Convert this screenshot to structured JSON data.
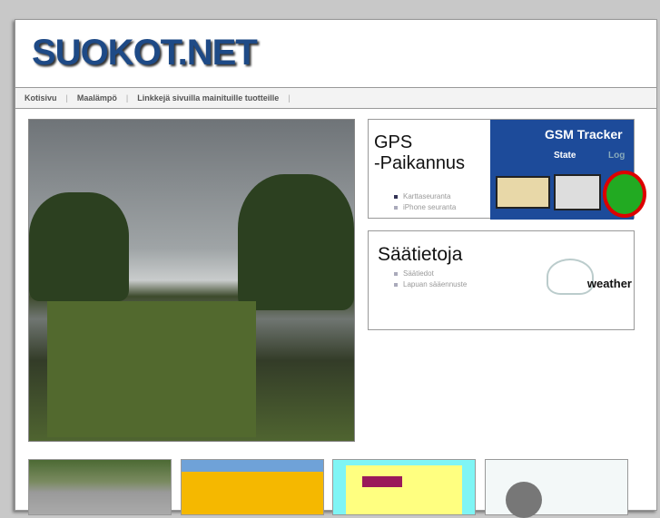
{
  "site": {
    "logo": "SUOKOT.NET"
  },
  "nav": {
    "items": [
      "Kotisivu",
      "Maalämpö",
      "Linkkejä sivuilla mainituille tuotteille"
    ],
    "separator": "|"
  },
  "gps": {
    "title_line1": "GPS",
    "title_line2": "-Paikannus",
    "links": [
      "Karttaseuranta",
      "iPhone seuranta"
    ],
    "image_text": "GSM Tracker",
    "tabs": [
      "State",
      "Log"
    ]
  },
  "weather": {
    "title": "Säätietoja",
    "links": [
      "Säätiedot",
      "Lapuan sääennuste"
    ],
    "image_text": "weather"
  }
}
